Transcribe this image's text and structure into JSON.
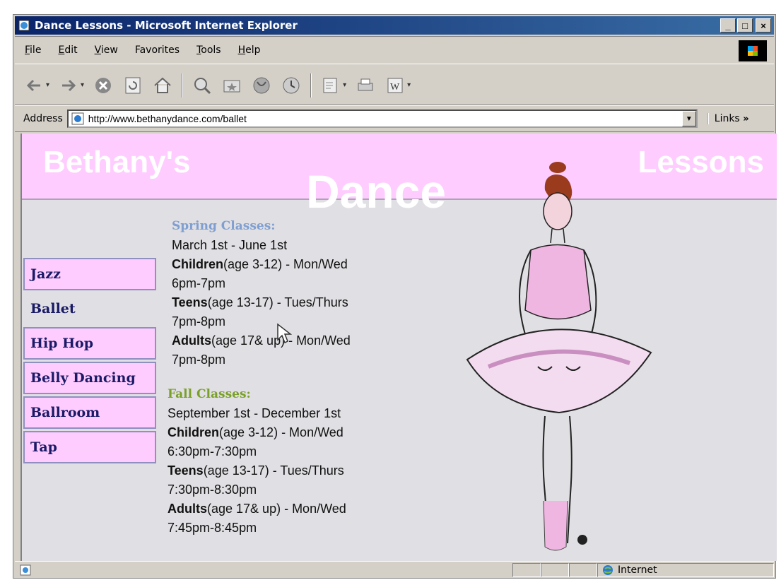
{
  "window": {
    "title": "Dance Lessons - Microsoft Internet Explorer",
    "minimize": "_",
    "maximize": "□",
    "close": "×"
  },
  "menu": {
    "items": [
      {
        "first": "F",
        "rest": "ile"
      },
      {
        "first": "E",
        "rest": "dit"
      },
      {
        "first": "V",
        "rest": "iew"
      },
      {
        "first": "Fa",
        "rest": "vorites"
      },
      {
        "first": "T",
        "rest": "ools"
      },
      {
        "first": "H",
        "rest": "elp"
      }
    ]
  },
  "toolbar": {
    "icons": [
      "back-icon",
      "forward-icon",
      "stop-icon",
      "refresh-icon",
      "home-icon",
      "search-icon",
      "favorites-icon",
      "history-icon",
      "media-icon",
      "mail-icon",
      "print-icon",
      "edit-word-icon"
    ]
  },
  "address": {
    "label": "Address",
    "url": "http://www.bethanydance.com/ballet",
    "links_label": "Links",
    "links_chevron": "»"
  },
  "banner": {
    "left": "Bethany's",
    "center": "Dance",
    "right": "Lessons"
  },
  "nav": {
    "items": [
      "Jazz",
      "Ballet",
      "Hip Hop",
      "Belly Dancing",
      "Ballroom",
      "Tap"
    ]
  },
  "spring": {
    "heading": "Spring Classes:",
    "dates": "March 1st - June 1st",
    "children_label": "Children",
    "children_detail": "(age 3-12) - Mon/Wed",
    "children_time": "6pm-7pm",
    "teens_label": "Teens",
    "teens_detail": "(age 13-17) - Tues/Thurs",
    "teens_time": "7pm-8pm",
    "adults_label": "Adults",
    "adults_detail": "(age 17& up) - Mon/Wed",
    "adults_time": "7pm-8pm"
  },
  "fall": {
    "heading": "Fall Classes:",
    "dates": "September 1st - December 1st",
    "children_label": "Children",
    "children_detail": "(age 3-12) - Mon/Wed",
    "children_time": "6:30pm-7:30pm",
    "teens_label": "Teens",
    "teens_detail": "(age 13-17) - Tues/Thurs",
    "teens_time": "7:30pm-8:30pm",
    "adults_label": "Adults",
    "adults_detail": "(age 17& up) - Mon/Wed",
    "adults_time": "7:45pm-8:45pm"
  },
  "status": {
    "zone": "Internet"
  },
  "colors": {
    "banner_pink": "#ffccff",
    "nav_text": "#1a1a66",
    "spring_heading": "#7f9fd0",
    "fall_heading": "#7aa02a",
    "titlebar": "#0a246a"
  }
}
